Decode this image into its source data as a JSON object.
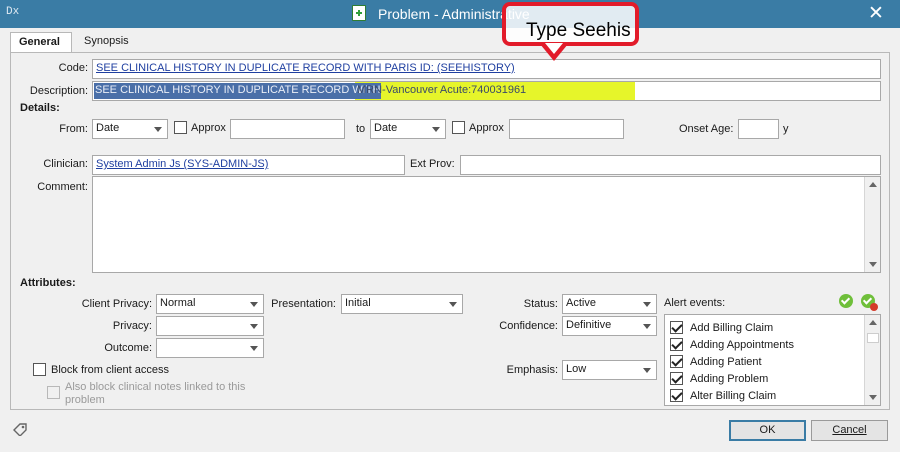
{
  "window": {
    "app_icon": "Dx",
    "title": "Problem - Administrative",
    "close_glyph": "✕"
  },
  "tabs": [
    {
      "label": "General",
      "active": true
    },
    {
      "label": "Synopsis",
      "active": false
    }
  ],
  "general": {
    "code_label": "Code:",
    "code_value": "SEE CLINICAL HISTORY IN DUPLICATE RECORD WITH PARIS ID: (SEEHISTORY)",
    "description_label": "Description:",
    "description_selected": "SEE CLINICAL HISTORY IN DUPLICATE RECORD WITH ",
    "description_highlight": "MRN-Vancouver Acute:740031961",
    "details_header": "Details:",
    "from_label": "From:",
    "from_type": "Date",
    "approx_label": "Approx",
    "to_label": "to",
    "to_type": "Date",
    "approx2_label": "Approx",
    "onset_age_label": "Onset Age:",
    "onset_age_unit": "y",
    "clinician_label": "Clinician:",
    "clinician_value": "System Admin Js (SYS-ADMIN-JS)",
    "ext_prov_label": "Ext Prov:",
    "comment_label": "Comment:",
    "attributes_header": "Attributes:",
    "client_privacy_label": "Client Privacy:",
    "client_privacy_value": "Normal",
    "privacy_label": "Privacy:",
    "outcome_label": "Outcome:",
    "presentation_label": "Presentation:",
    "presentation_value": "Initial",
    "status_label": "Status:",
    "status_value": "Active",
    "confidence_label": "Confidence:",
    "confidence_value": "Definitive",
    "emphasis_label": "Emphasis:",
    "emphasis_value": "Low",
    "block_client_label": "Block from client access",
    "also_block_line1": "Also block clinical notes linked to this",
    "also_block_line2": "problem",
    "alert_events_label": "Alert events:",
    "alert_events": [
      {
        "label": "Add Billing Claim",
        "checked": true
      },
      {
        "label": "Adding Appointments",
        "checked": true
      },
      {
        "label": "Adding Patient",
        "checked": true
      },
      {
        "label": "Adding Problem",
        "checked": true
      },
      {
        "label": "Alter Billing Claim",
        "checked": true
      }
    ]
  },
  "buttons": {
    "ok": "OK",
    "cancel": "Cancel"
  },
  "annotation": {
    "text": "Type Seehis",
    "color": "#e21b2a"
  },
  "colors": {
    "titlebar": "#3a7ca5",
    "highlight": "#e6f52a",
    "selection": "#4a6fa8",
    "link": "#1f3fa0"
  }
}
